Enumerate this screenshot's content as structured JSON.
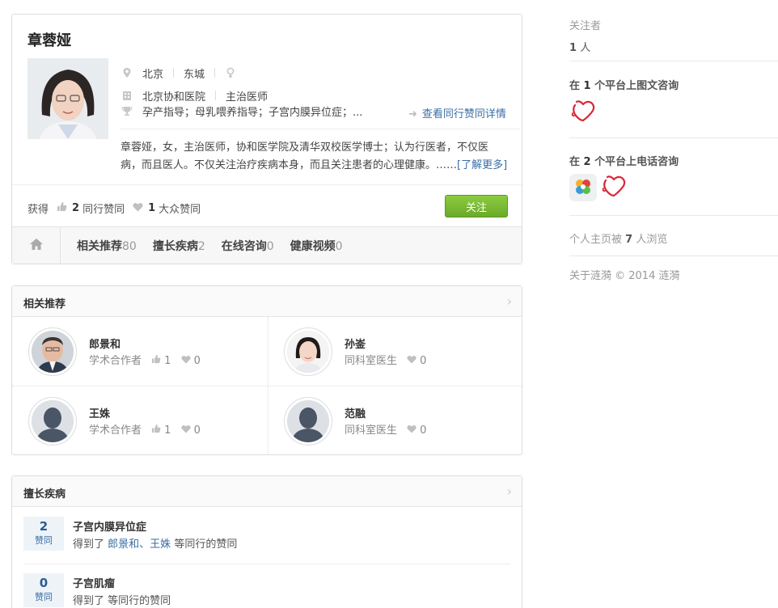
{
  "profile": {
    "name": "章蓉娅",
    "city": "北京",
    "district": "东城",
    "hospital": "北京协和医院",
    "title": "主治医师",
    "specialties": "孕产指导；母乳喂养指导；子宫内膜异位症；...",
    "peer_link": "查看同行赞同详情",
    "bio": "章蓉娅，女，主治医师，协和医学院及清华双校医学博士；认为行医者，不仅医病，而且医人。不仅关注治疗疾病本身，而且关注患者的心理健康。……",
    "bio_more": "[了解更多]",
    "stats_prefix": "获得",
    "peer_votes": "2",
    "peer_votes_label": "同行赞同",
    "public_votes": "1",
    "public_votes_label": "大众赞同",
    "follow_label": "关注"
  },
  "tabs": [
    {
      "label": "相关推荐",
      "count": "80"
    },
    {
      "label": "擅长疾病",
      "count": "2"
    },
    {
      "label": "在线咨询",
      "count": "0"
    },
    {
      "label": "健康视频",
      "count": "0"
    }
  ],
  "recommend": {
    "title": "相关推荐",
    "items": [
      {
        "name": "郎景和",
        "relation": "学术合作者",
        "likes": "1",
        "hearts": "0"
      },
      {
        "name": "孙崟",
        "relation": "同科室医生",
        "hearts": "0"
      },
      {
        "name": "王姝",
        "relation": "学术合作者",
        "likes": "1",
        "hearts": "0"
      },
      {
        "name": "范融",
        "relation": "同科室医生",
        "hearts": "0"
      }
    ]
  },
  "diseases": {
    "title": "擅长疾病",
    "vote_label": "赞同",
    "items": [
      {
        "count": "2",
        "name": "子宫内膜异位症",
        "prefix": "得到了",
        "peers": "郎景和、王姝",
        "suffix": "等同行的赞同"
      },
      {
        "count": "0",
        "name": "子宫肌瘤",
        "prefix": "得到了",
        "suffix": "等同行的赞同"
      }
    ]
  },
  "sidebar": {
    "followers_label": "关注者",
    "followers_count": "1",
    "followers_unit": "人",
    "text_consult_pre": "在",
    "text_consult_num": "1",
    "text_consult_post": "个平台上图文咨询",
    "phone_consult_pre": "在",
    "phone_consult_num": "2",
    "phone_consult_post": "个平台上电话咨询",
    "views_pre": "个人主页被",
    "views_num": "7",
    "views_post": "人浏览",
    "footer": "关于涟漪 © 2014 涟漪"
  },
  "colors": {
    "accent": "#3a6ea5",
    "follow": "#7aba33",
    "heart": "#d9283a"
  }
}
